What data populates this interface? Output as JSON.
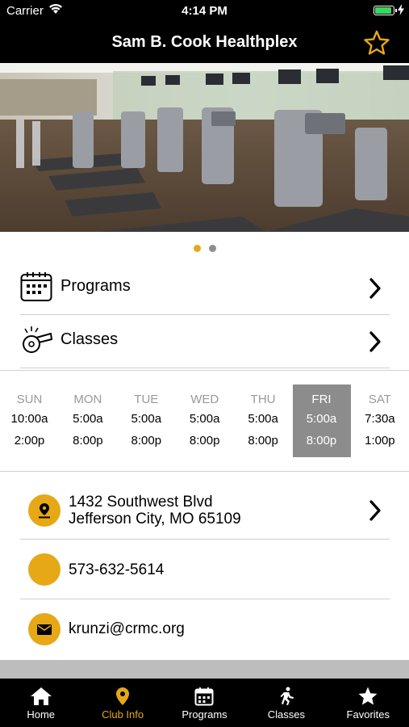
{
  "status_bar": {
    "carrier": "Carrier",
    "time": "4:14 PM",
    "battery_level": 1.0,
    "battery_color": "#3ad65d"
  },
  "nav": {
    "title": "Sam B. Cook Healthplex",
    "favorite_icon": "star-outline-icon"
  },
  "hero": {
    "image_alt": "gym treadmills photo",
    "page_count": 2,
    "active_page": 1
  },
  "menu": {
    "programs_label": "Programs",
    "classes_label": "Classes"
  },
  "schedule": [
    {
      "day": "SUN",
      "open": "10:00a",
      "close": "2:00p"
    },
    {
      "day": "MON",
      "open": "5:00a",
      "close": "8:00p"
    },
    {
      "day": "TUE",
      "open": "5:00a",
      "close": "8:00p"
    },
    {
      "day": "WED",
      "open": "5:00a",
      "close": "8:00p"
    },
    {
      "day": "THU",
      "open": "5:00a",
      "close": "8:00p"
    },
    {
      "day": "FRI",
      "open": "5:00a",
      "close": "8:00p"
    },
    {
      "day": "SAT",
      "open": "7:30a",
      "close": "1:00p"
    }
  ],
  "schedule_selected_day": "FRI",
  "contact": {
    "address_line1": "1432 Southwest Blvd",
    "address_line2": "Jefferson City, MO 65109",
    "phone": "573-632-5614",
    "email": "krunzi@crmc.org"
  },
  "tabs": [
    {
      "label": "Home",
      "icon": "home-icon"
    },
    {
      "label": "Club Info",
      "icon": "map-pin-icon"
    },
    {
      "label": "Programs",
      "icon": "calendar-icon"
    },
    {
      "label": "Classes",
      "icon": "running-person-icon"
    },
    {
      "label": "Favorites",
      "icon": "star-icon"
    }
  ],
  "active_tab": "Club Info",
  "colors": {
    "accent": "#e6a817",
    "bar": "#000000",
    "selected_day": "#8c8c8c",
    "divider": "#cfcfcf"
  }
}
